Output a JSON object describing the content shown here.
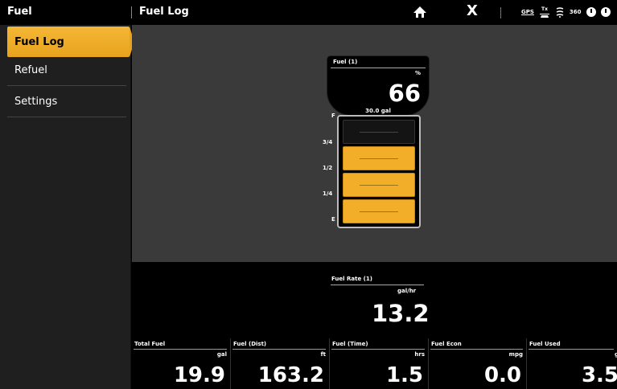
{
  "topbar": {
    "app_title": "Fuel",
    "page_title": "Fuel Log",
    "close_glyph": "X",
    "status": {
      "gps": "GPS",
      "tx": "Tx",
      "n360": "360"
    }
  },
  "sidebar": {
    "items": [
      {
        "label": "Fuel Log",
        "active": true
      },
      {
        "label": "Refuel",
        "active": false
      },
      {
        "label": "Settings",
        "active": false
      }
    ]
  },
  "gauge": {
    "label": "Fuel (1)",
    "unit": "%",
    "value": "66",
    "volume": "30.0 gal",
    "level_fraction": 0.66,
    "ticks": [
      "F",
      "3/4",
      "1/2",
      "1/4",
      "E"
    ],
    "fill_color": "#f2ae28"
  },
  "fuel_rate": {
    "label": "Fuel Rate (1)",
    "unit": "gal/hr",
    "value": "13.2"
  },
  "data_boxes": [
    {
      "label": "Total Fuel",
      "unit": "gal",
      "value": "19.9"
    },
    {
      "label": "Fuel (Dist)",
      "unit": "ft",
      "value": "163.2"
    },
    {
      "label": "Fuel (Time)",
      "unit": "hrs",
      "value": "1.5"
    },
    {
      "label": "Fuel Econ",
      "unit": "mpg",
      "value": "0.0"
    },
    {
      "label": "Fuel Used",
      "unit": "g",
      "value": "3.5"
    }
  ],
  "colors": {
    "accent": "#f2ae28",
    "background": "#3a3a3a",
    "sidebar": "#1f1f1f"
  }
}
